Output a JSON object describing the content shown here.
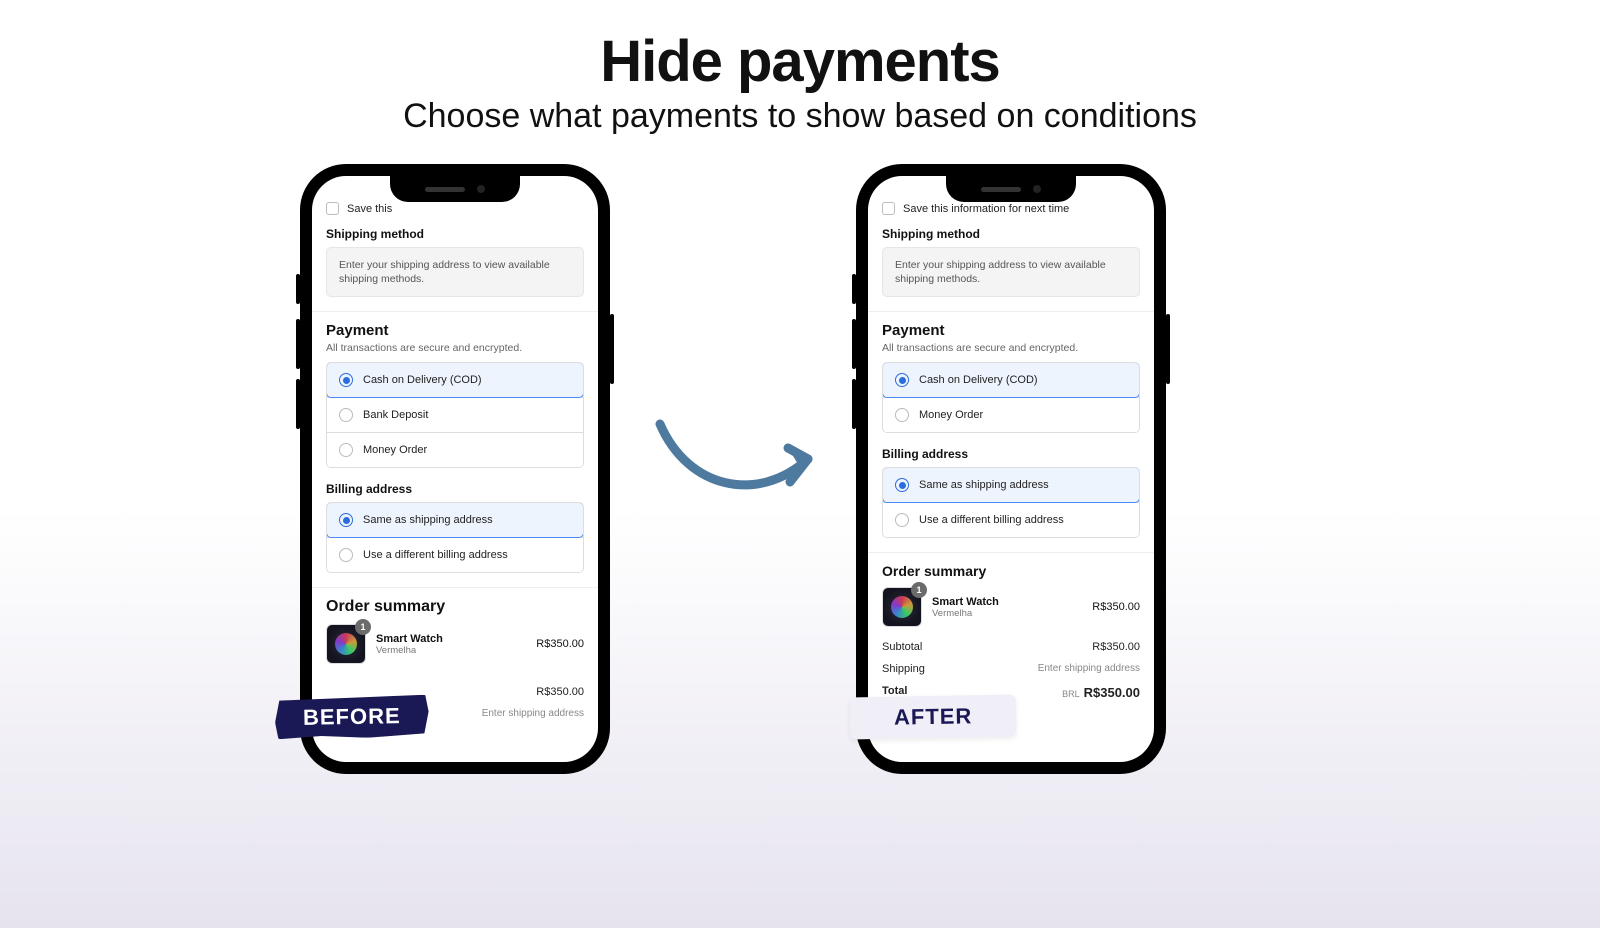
{
  "headline": "Hide payments",
  "subhead": "Choose what payments to show based on conditions",
  "labels": {
    "before": "BEFORE",
    "after": "AFTER"
  },
  "common": {
    "save_info": "Save this information for next time",
    "save_info_truncated": "Save this ",
    "shipping_method": "Shipping method",
    "shipping_hint": "Enter your shipping address to view available shipping methods.",
    "payment_title": "Payment",
    "payment_sub": "All transactions are secure and encrypted.",
    "billing_title": "Billing address",
    "billing_same": "Same as shipping address",
    "billing_diff": "Use a different billing address",
    "order_title": "Order summary",
    "product_name": "Smart Watch",
    "product_variant": "Vermelha",
    "product_qty": "1",
    "product_price": "R$350.00",
    "subtotal_label": "Subtotal",
    "subtotal_value": "R$350.00",
    "shipping_label": "Shipping",
    "shipping_value_hint": "Enter shipping address",
    "total_label": "Total",
    "total_currency": "BRL",
    "total_value": "R$350.00"
  },
  "before": {
    "payment_options": [
      {
        "label": "Cash on Delivery (COD)",
        "selected": true
      },
      {
        "label": "Bank Deposit",
        "selected": false
      },
      {
        "label": "Money Order",
        "selected": false
      }
    ]
  },
  "after": {
    "payment_options": [
      {
        "label": "Cash on Delivery (COD)",
        "selected": true
      },
      {
        "label": "Money Order",
        "selected": false
      }
    ]
  }
}
